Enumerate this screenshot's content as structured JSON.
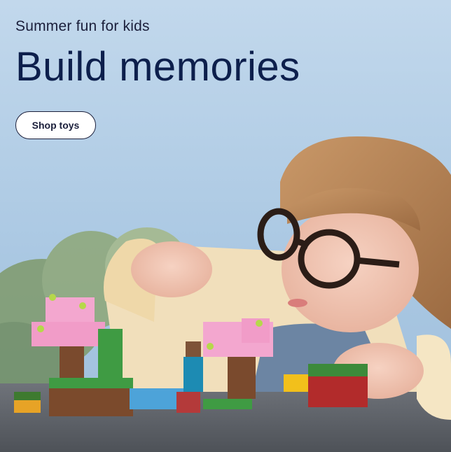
{
  "hero": {
    "eyebrow": "Summer fun for kids",
    "headline": "Build memories",
    "cta_label": "Shop toys"
  },
  "colors": {
    "background_sky": "#b9d2e8",
    "headline_text": "#0d1f4c",
    "button_bg": "#ffffff",
    "button_border": "#1b1f3b"
  },
  "image": {
    "subject": "child-building-toy-bricks"
  }
}
